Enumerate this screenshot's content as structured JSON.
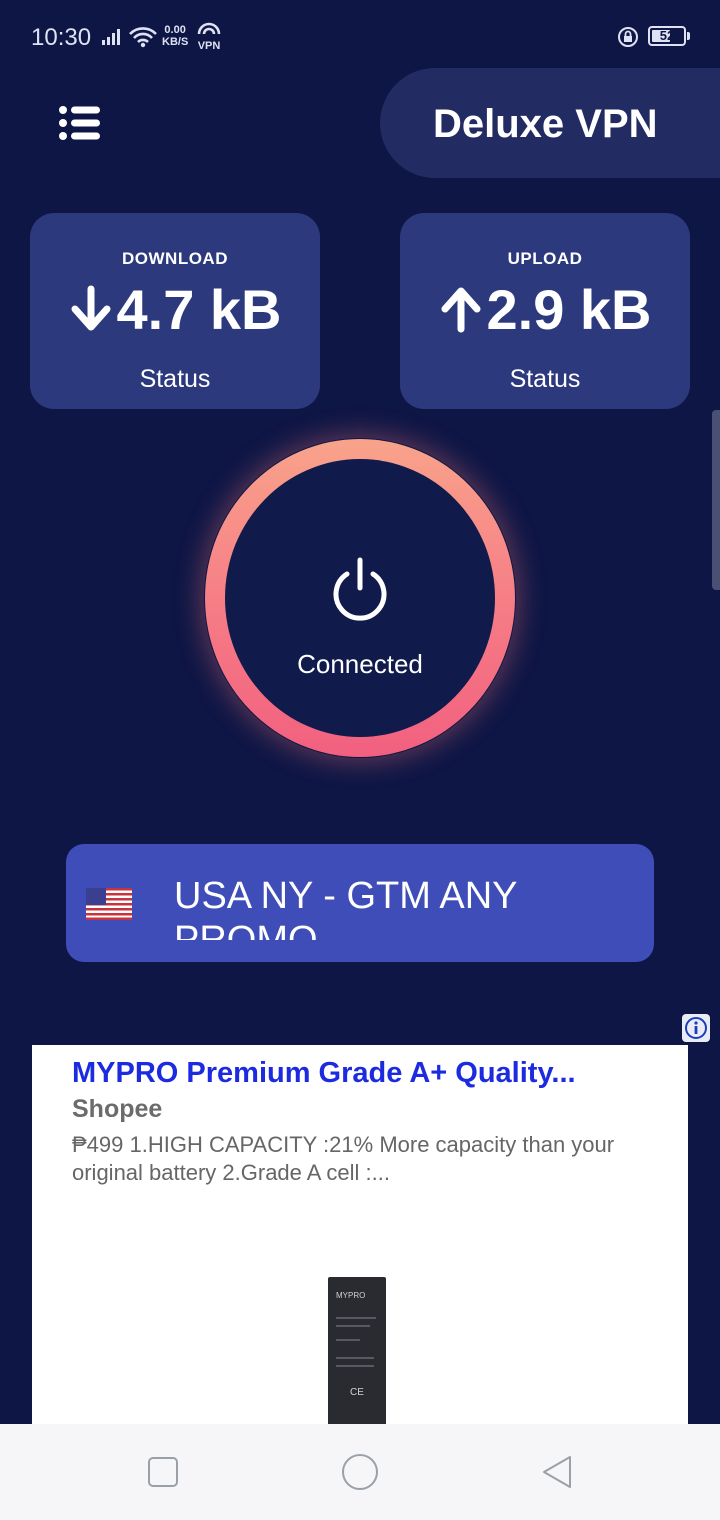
{
  "status_bar": {
    "time": "10:30",
    "net_speed_value": "0.00",
    "net_speed_unit": "KB/S",
    "vpn_label": "VPN",
    "battery": "52",
    "icons": [
      "signal-icon",
      "wifi-icon",
      "vpn-key-icon",
      "lock-rotation-icon",
      "battery-icon"
    ]
  },
  "header": {
    "title": "Deluxe VPN",
    "menu_icon": "menu-list-icon"
  },
  "stats": {
    "download": {
      "label": "DOWNLOAD",
      "value": "4.7 kB",
      "sub": "Status",
      "icon": "arrow-down-icon"
    },
    "upload": {
      "label": "UPLOAD",
      "value": "2.9 kB",
      "sub": "Status",
      "icon": "arrow-up-icon"
    }
  },
  "connection": {
    "status": "Connected",
    "icon": "power-icon"
  },
  "server": {
    "name": "USA NY - GTM ANY PROMO",
    "flag_icon": "us-flag-icon"
  },
  "ad": {
    "title": "MYPRO Premium Grade A+ Quality...",
    "advertiser": "Shopee",
    "description": "₱499 1.HIGH CAPACITY :21% More capacity than your original battery 2.Grade A cell :...",
    "product_brand": "MYPRO",
    "product_mark": "CE"
  },
  "navbar": {
    "icons": [
      "recent-apps-icon",
      "home-icon",
      "back-icon"
    ]
  },
  "colors": {
    "background": "#0e1645",
    "card": "#2c3a7d",
    "server_button": "#3f4db8",
    "ring_top": "#f9a38a",
    "ring_bottom": "#f2607f",
    "ad_title": "#1c2ae0"
  }
}
